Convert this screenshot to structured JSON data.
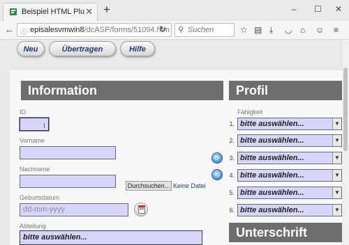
{
  "browser": {
    "tab_title": "Beispiel HTML Plus Forms...",
    "tab_close": "✕",
    "new_tab": "+",
    "window_controls": {
      "minimize": "–",
      "maximize": "☐",
      "close": "✕"
    },
    "url_host": "episalesvmwin8",
    "url_path": "/dcASP/forms/51094.htm",
    "search_placeholder": "Suchen",
    "toolbar_icons": [
      "star-icon",
      "reading-list-icon",
      "download-icon",
      "pocket-icon",
      "home-icon",
      "chat-icon",
      "menu-icon"
    ]
  },
  "toolbar": {
    "new_label": "Neu",
    "submit_label": "Übertragen",
    "help_label": "Hilfe"
  },
  "information": {
    "header": "Information",
    "id_label": "ID",
    "firstname_label": "Vorname",
    "lastname_label": "Nachname",
    "browse_label": "Durchsuchen...",
    "no_file_label": "Keine Datei a",
    "birthdate_label": "Geburtsdatum",
    "birthdate_placeholder": "dd-mm-yyyy",
    "department_label": "Abteilung",
    "department_value": "bitte auswählen..."
  },
  "profil": {
    "header": "Profil",
    "skill_label": "Fähigkeit",
    "skills": [
      {
        "num": "1.",
        "value": "bitte auswählen..."
      },
      {
        "num": "2.",
        "value": "bitte auswählen..."
      },
      {
        "num": "3.",
        "value": "bitte auswählen..."
      },
      {
        "num": "4.",
        "value": "bitte auswählen..."
      },
      {
        "num": "5.",
        "value": "bitte auswählen..."
      },
      {
        "num": "6.",
        "value": "bitte auswählen..."
      }
    ],
    "signature_header": "Unterschrift"
  },
  "colors": {
    "input_bg": "#d6d6fb",
    "header_bg": "#6d6d6d",
    "button_text": "#1d3a73"
  }
}
